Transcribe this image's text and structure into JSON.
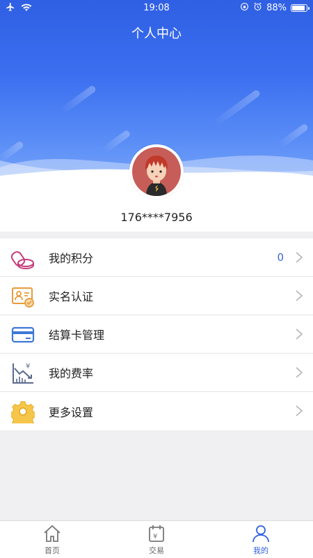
{
  "status_bar": {
    "time": "19:08",
    "battery": "88%",
    "battery_level": 0.88
  },
  "header": {
    "title": "个人中心"
  },
  "profile": {
    "phone": "176****7956"
  },
  "menu": {
    "items": [
      {
        "label": "我的积分",
        "value": "0",
        "icon": "coins-icon"
      },
      {
        "label": "实名认证",
        "icon": "id-card-icon"
      },
      {
        "label": "结算卡管理",
        "icon": "bank-card-icon"
      },
      {
        "label": "我的费率",
        "icon": "rate-chart-icon"
      },
      {
        "label": "更多设置",
        "icon": "gear-icon"
      }
    ]
  },
  "tabbar": {
    "tabs": [
      {
        "label": "首页",
        "icon": "home-icon"
      },
      {
        "label": "交易",
        "icon": "calendar-yen-icon"
      },
      {
        "label": "我的",
        "icon": "user-icon",
        "active": true
      }
    ]
  },
  "colors": {
    "primary": "#2f5fe3",
    "value_blue": "#3a66d8",
    "background": "#f0f0f2"
  }
}
